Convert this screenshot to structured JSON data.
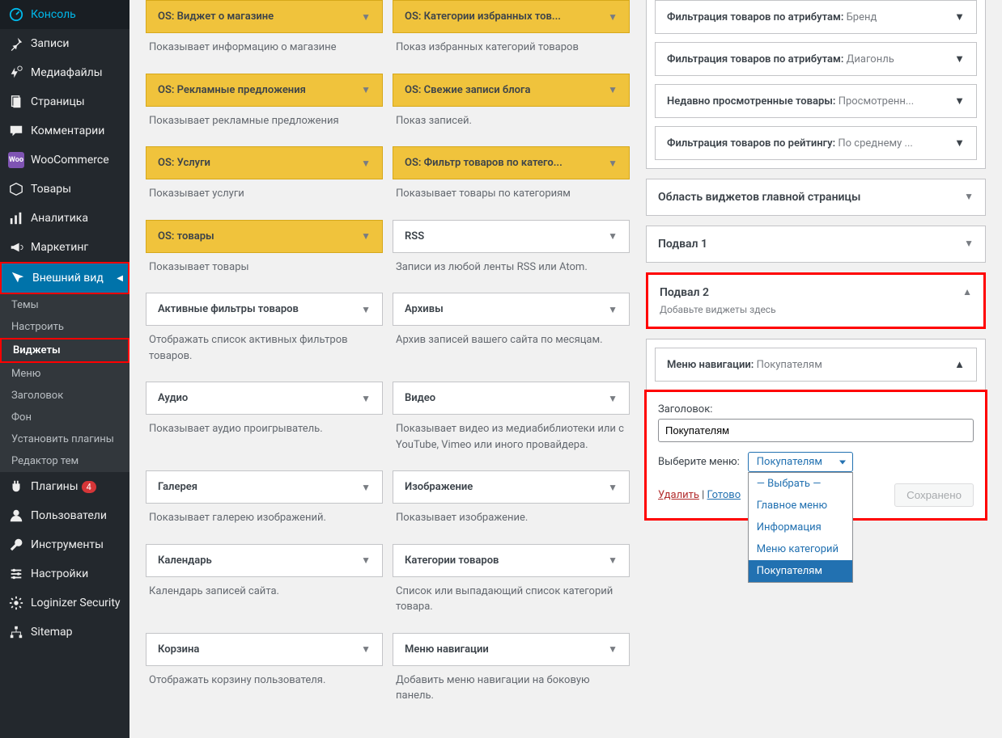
{
  "sidebar": {
    "items": [
      {
        "icon": "dashboard",
        "label": "Консоль"
      },
      {
        "icon": "pin",
        "label": "Записи"
      },
      {
        "icon": "media",
        "label": "Медиафайлы"
      },
      {
        "icon": "pages",
        "label": "Страницы"
      },
      {
        "icon": "comments",
        "label": "Комментарии"
      },
      {
        "icon": "woo",
        "label": "WooCommerce"
      },
      {
        "icon": "products",
        "label": "Товары"
      },
      {
        "icon": "analytics",
        "label": "Аналитика"
      },
      {
        "icon": "marketing",
        "label": "Маркетинг"
      },
      {
        "icon": "appearance",
        "label": "Внешний вид",
        "active": true
      },
      {
        "icon": "plugins",
        "label": "Плагины",
        "count": "4"
      },
      {
        "icon": "users",
        "label": "Пользователи"
      },
      {
        "icon": "tools",
        "label": "Инструменты"
      },
      {
        "icon": "settings",
        "label": "Настройки"
      },
      {
        "icon": "loginizer",
        "label": "Loginizer Security"
      },
      {
        "icon": "sitemap",
        "label": "Sitemap"
      }
    ],
    "submenu": [
      {
        "label": "Темы"
      },
      {
        "label": "Настроить"
      },
      {
        "label": "Виджеты",
        "current": true
      },
      {
        "label": "Меню"
      },
      {
        "label": "Заголовок"
      },
      {
        "label": "Фон"
      },
      {
        "label": "Установить плагины"
      },
      {
        "label": "Редактор тем"
      }
    ]
  },
  "widgets_left": [
    {
      "title": "OS: Виджет о магазине",
      "yellow": true,
      "desc": "Показывает информацию о магазине"
    },
    {
      "title": "OS: Рекламные предложения",
      "yellow": true,
      "desc": "Показывает рекламные предложения"
    },
    {
      "title": "OS: Услуги",
      "yellow": true,
      "desc": "Показывает услуги"
    },
    {
      "title": "OS: товары",
      "yellow": true,
      "desc": "Показывает товары"
    },
    {
      "title": "Активные фильтры товаров",
      "yellow": false,
      "desc": "Отображать список активных фильтров товаров."
    },
    {
      "title": "Аудио",
      "yellow": false,
      "desc": "Показывает аудио проигрыватель."
    },
    {
      "title": "Галерея",
      "yellow": false,
      "desc": "Показывает галерею изображений."
    },
    {
      "title": "Календарь",
      "yellow": false,
      "desc": "Календарь записей сайта."
    },
    {
      "title": "Корзина",
      "yellow": false,
      "desc": "Отображать корзину пользователя."
    }
  ],
  "widgets_right": [
    {
      "title": "OS: Категории избранных тов...",
      "yellow": true,
      "desc": "Показ избранных категорий товаров"
    },
    {
      "title": "OS: Свежие записи блога",
      "yellow": true,
      "desc": "Показ записей."
    },
    {
      "title": "OS: Фильтр товаров по катего...",
      "yellow": true,
      "desc": "Показывает товары по категориям"
    },
    {
      "title": "RSS",
      "yellow": false,
      "desc": "Записи из любой ленты RSS или Atom."
    },
    {
      "title": "Архивы",
      "yellow": false,
      "desc": "Архив записей вашего сайта по месяцам."
    },
    {
      "title": "Видео",
      "yellow": false,
      "desc": "Показывает видео из медиабиблиотеки или с YouTube, Vimeo или иного провайдера."
    },
    {
      "title": "Изображение",
      "yellow": false,
      "desc": "Показывает изображение."
    },
    {
      "title": "Категории товаров",
      "yellow": false,
      "desc": "Список или выпадающий список категорий товара."
    },
    {
      "title": "Меню навигации",
      "yellow": false,
      "desc": "Добавить меню навигации на боковую панель."
    }
  ],
  "areas": {
    "top_widgets": [
      {
        "label": "Фильтрация товаров по атрибутам:",
        "value": "Бренд"
      },
      {
        "label": "Фильтрация товаров по атрибутам:",
        "value": "Диагонль"
      },
      {
        "label": "Недавно просмотренные товары:",
        "value": "Просмотренн..."
      },
      {
        "label": "Фильтрация товаров по рейтингу:",
        "value": "По среднему ..."
      }
    ],
    "area_homepage": "Область виджетов главной страницы",
    "area_footer1": "Подвал 1",
    "area_footer2": {
      "title": "Подвал 2",
      "sub": "Добавьте виджеты здесь",
      "widget": {
        "title": "Меню навигации:",
        "value": "Покупателям"
      }
    },
    "form": {
      "title_label": "Заголовок:",
      "title_value": "Покупателям",
      "menu_label": "Выберите меню:",
      "menu_selected": "Покупателям",
      "menu_options": [
        "— Выбрать —",
        "Главное меню",
        "Информация",
        "Меню категорий",
        "Покупателям"
      ],
      "delete": "Удалить",
      "done": "Готово",
      "saved": "Сохранено",
      "sep": " | "
    }
  }
}
